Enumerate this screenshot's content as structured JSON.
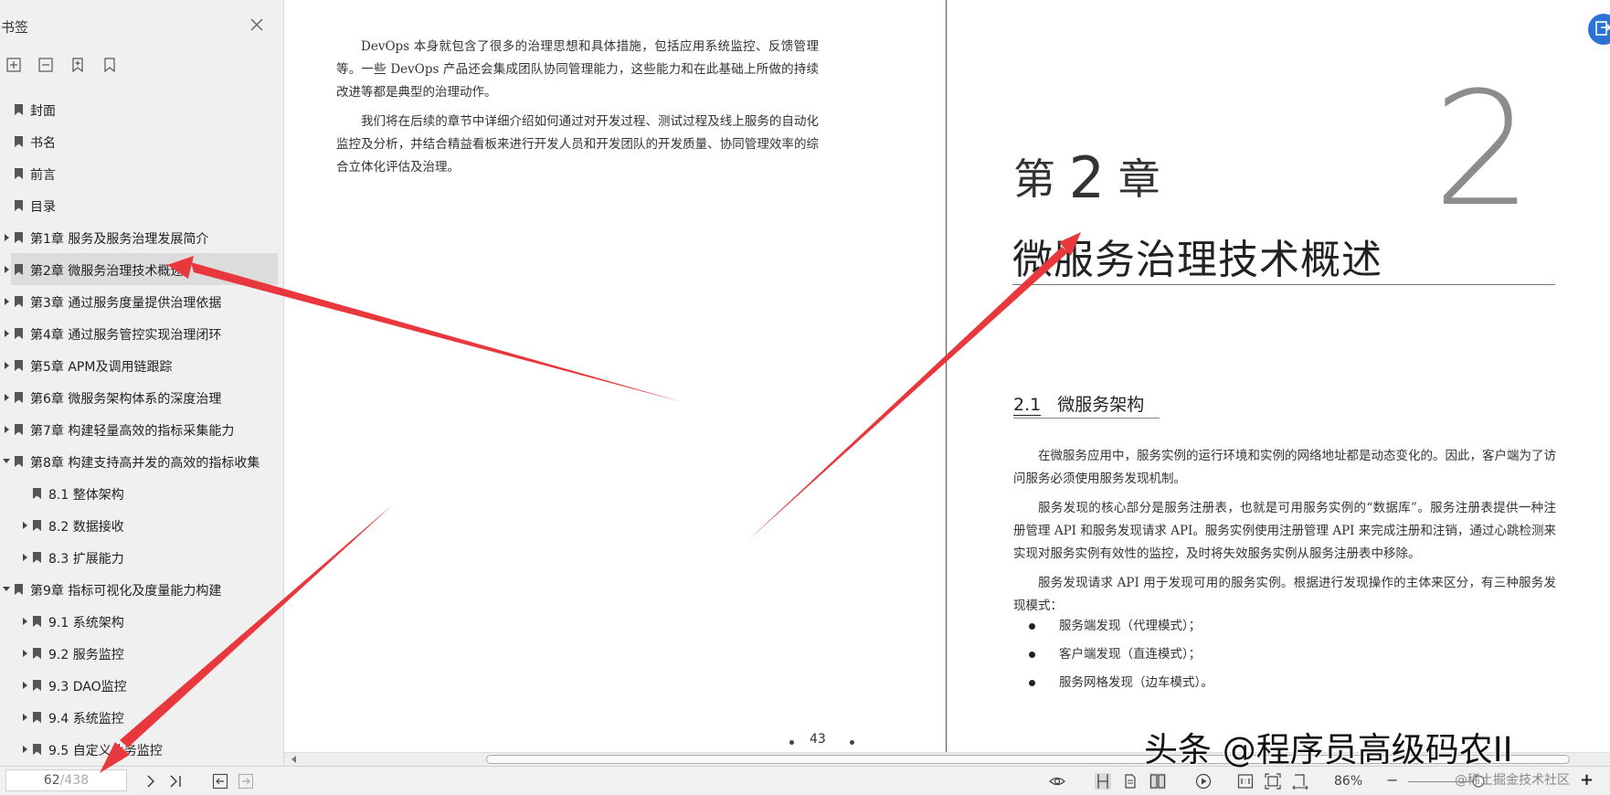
{
  "sidebar": {
    "title": "书签",
    "items": [
      {
        "label": "封面",
        "level": 0,
        "expander": "none"
      },
      {
        "label": "书名",
        "level": 0,
        "expander": "none"
      },
      {
        "label": "前言",
        "level": 0,
        "expander": "none"
      },
      {
        "label": "目录",
        "level": 0,
        "expander": "none"
      },
      {
        "label": "第1章 服务及服务治理发展简介",
        "level": 0,
        "expander": "collapsed"
      },
      {
        "label": "第2章 微服务治理技术概述",
        "level": 0,
        "expander": "collapsed",
        "selected": true
      },
      {
        "label": "第3章 通过服务度量提供治理依据",
        "level": 0,
        "expander": "collapsed"
      },
      {
        "label": "第4章 通过服务管控实现治理闭环",
        "level": 0,
        "expander": "collapsed"
      },
      {
        "label": "第5章 APM及调用链跟踪",
        "level": 0,
        "expander": "collapsed"
      },
      {
        "label": "第6章 微服务架构体系的深度治理",
        "level": 0,
        "expander": "collapsed"
      },
      {
        "label": "第7章 构建轻量高效的指标采集能力",
        "level": 0,
        "expander": "collapsed"
      },
      {
        "label": "第8章 构建支持高并发的高效的指标收集",
        "level": 0,
        "expander": "expanded"
      },
      {
        "label": "8.1 整体架构",
        "level": 1,
        "expander": "none"
      },
      {
        "label": "8.2 数据接收",
        "level": 1,
        "expander": "collapsed"
      },
      {
        "label": "8.3 扩展能力",
        "level": 1,
        "expander": "collapsed"
      },
      {
        "label": "第9章 指标可视化及度量能力构建",
        "level": 0,
        "expander": "expanded"
      },
      {
        "label": "9.1 系统架构",
        "level": 1,
        "expander": "collapsed"
      },
      {
        "label": "9.2 服务监控",
        "level": 1,
        "expander": "collapsed"
      },
      {
        "label": "9.3 DAO监控",
        "level": 1,
        "expander": "collapsed"
      },
      {
        "label": "9.4 系统监控",
        "level": 1,
        "expander": "collapsed"
      },
      {
        "label": "9.5 自定义业务监控",
        "level": 1,
        "expander": "collapsed"
      }
    ]
  },
  "left_page": {
    "paragraphs": [
      "DevOps 本身就包含了很多的治理思想和具体措施，包括应用系统监控、反馈管理等。一些 DevOps 产品还会集成团队协同管理能力，这些能力和在此基础上所做的持续改进等都是典型的治理动作。",
      "我们将在后续的章节中详细介绍如何通过对开发过程、测试过程及线上服务的自动化监控及分析，并结合精益看板来进行开发人员和开发团队的开发质量、协同管理效率的综合立体化评估及治理。"
    ],
    "page_number": "43"
  },
  "right_page": {
    "chapter_big_number": "2",
    "chapter_prefix": "第",
    "chapter_number": "2",
    "chapter_suffix": "章",
    "chapter_title": "微服务治理技术概述",
    "section_number": "2.1",
    "section_title": "微服务架构",
    "paragraphs": [
      "在微服务应用中，服务实例的运行环境和实例的网络地址都是动态变化的。因此，客户端为了访问服务必须使用服务发现机制。",
      "服务发现的核心部分是服务注册表，也就是可用服务实例的“数据库”。服务注册表提供一种注册管理 API 和服务发现请求 API。服务实例使用注册管理 API 来完成注册和注销，通过心跳检测来实现对服务实例有效性的监控，及时将失效服务实例从服务注册表中移除。",
      "服务发现请求 API 用于发现可用的服务实例。根据进行发现操作的主体来区分，有三种服务发现模式："
    ],
    "bullets": [
      "服务端发现（代理模式）；",
      "客户端发现（直连模式）；",
      "服务网格发现（边车模式）。"
    ]
  },
  "statusbar": {
    "current_page": "62",
    "total_pages": "/438",
    "zoom": "86%"
  },
  "watermark": {
    "main": "头条 @程序员高级码农II",
    "sub": "@稀土掘金技术社区"
  },
  "colors": {
    "arrow": "#e8383d",
    "sidebar_bg": "#f0f0f0",
    "selected_bg": "#dcdcdc",
    "corner_button": "#2b74d6"
  }
}
